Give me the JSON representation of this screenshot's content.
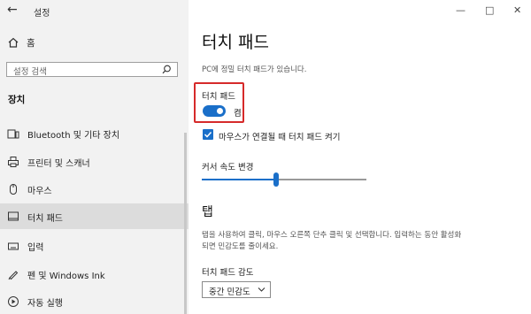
{
  "window": {
    "title": "설정"
  },
  "sidebar": {
    "home_label": "홈",
    "search_placeholder": "설정 검색",
    "section_title": "장치",
    "items": [
      {
        "label": "Bluetooth 및 기타 장치",
        "icon": "bluetooth-devices-icon"
      },
      {
        "label": "프린터 및 스캐너",
        "icon": "printer-icon"
      },
      {
        "label": "마우스",
        "icon": "mouse-icon"
      },
      {
        "label": "터치 패드",
        "icon": "touchpad-icon",
        "selected": true
      },
      {
        "label": "입력",
        "icon": "keyboard-icon"
      },
      {
        "label": "펜 및 Windows Ink",
        "icon": "pen-icon"
      },
      {
        "label": "자동 실행",
        "icon": "autoplay-icon"
      }
    ]
  },
  "main": {
    "title": "터치 패드",
    "subtitle": "PC에 정밀 터치 패드가 있습니다.",
    "touchpad_toggle": {
      "label": "터치 패드",
      "state_label": "켬",
      "on": true
    },
    "mouse_checkbox": {
      "label": "마우스가 연결될 때 터치 패드 켜기",
      "checked": true
    },
    "cursor_speed": {
      "label": "커서 속도 변경",
      "value": 0.45
    },
    "tap_section": {
      "heading": "탭",
      "description": "탭을 사용하여 클릭, 마우스 오른쪽 단추 클릭 및 선택합니다. 입력하는 동안 활성화되면 민감도를 줄이세요."
    },
    "sensitivity": {
      "label": "터치 패드 감도",
      "value": "중간 민감도"
    }
  },
  "colors": {
    "accent": "#1a6fc9",
    "highlight": "#d62a2a"
  }
}
